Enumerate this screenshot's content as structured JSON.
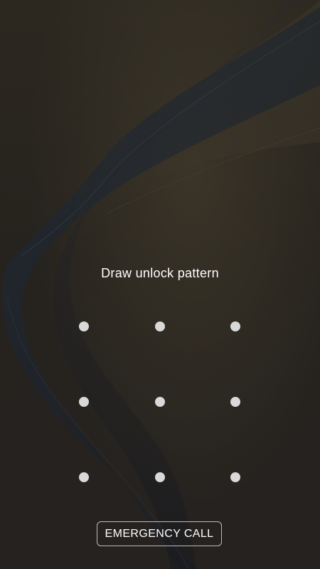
{
  "lock_screen": {
    "prompt_text": "Draw unlock pattern",
    "emergency_call_label": "EMERGENCY CALL"
  },
  "pattern_grid": {
    "rows": 3,
    "columns": 3,
    "dot_color": "#d9d9d9"
  },
  "colors": {
    "background": "#23201c",
    "wave_accent": "#1e2a3a",
    "text": "#ffffff"
  }
}
